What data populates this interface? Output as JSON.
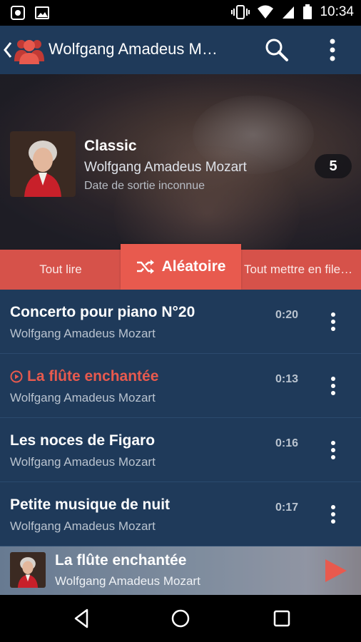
{
  "status_bar": {
    "time": "10:34",
    "left_icons": [
      "screenshot-icon",
      "image-icon"
    ],
    "right_icons": [
      "vibrate-icon",
      "wifi-icon",
      "signal-icon",
      "battery-icon"
    ]
  },
  "app_bar": {
    "title": "Wolfgang Amadeus M…",
    "icons": [
      "back-arrow-icon",
      "artist-group-icon",
      "search-icon",
      "more-vert-icon"
    ]
  },
  "album": {
    "title": "Classic",
    "artist": "Wolfgang Amadeus Mozart",
    "release_date": "Date de sortie inconnue",
    "track_count": "5"
  },
  "actions": {
    "play_all": "Tout lire",
    "shuffle": "Aléatoire",
    "enqueue_all": "Tout mettre en file…"
  },
  "tracks": [
    {
      "title": "Concerto pour piano N°20",
      "artist": "Wolfgang Amadeus Mozart",
      "duration": "0:20",
      "playing": false
    },
    {
      "title": "La flûte enchantée",
      "artist": "Wolfgang Amadeus Mozart",
      "duration": "0:13",
      "playing": true
    },
    {
      "title": "Les noces de Figaro",
      "artist": "Wolfgang Amadeus Mozart",
      "duration": "0:16",
      "playing": false
    },
    {
      "title": "Petite musique de nuit",
      "artist": "Wolfgang Amadeus Mozart",
      "duration": "0:17",
      "playing": false
    }
  ],
  "now_playing": {
    "title": "La flûte enchantée",
    "artist": "Wolfgang Amadeus Mozart"
  },
  "colors": {
    "primary": "#1f3a5a",
    "accent": "#e85a4e",
    "action_bar": "#d6524a"
  },
  "nav_bar": {
    "icons": [
      "back-triangle-icon",
      "home-circle-icon",
      "recents-square-icon"
    ]
  }
}
